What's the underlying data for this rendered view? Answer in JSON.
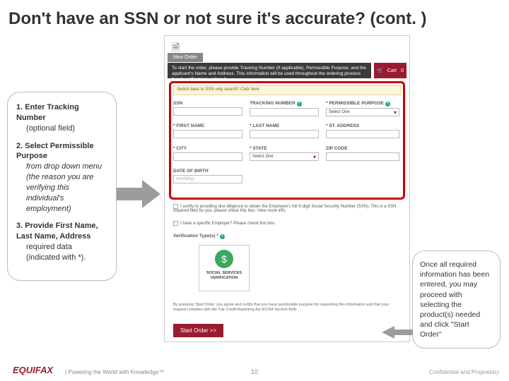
{
  "title": "Don't have an SSN or not sure it's accurate? (cont. )",
  "callout_left": {
    "item1_num": "1.",
    "item1_bold": "Enter Tracking Number",
    "item1_rest": " (optional field)",
    "item2_num": "2.",
    "item2_bold": "Select Permissible Purpose",
    "item2_rest": " from drop down menu (the reason you are verifying this individual's employment)",
    "item3_num": "3.",
    "item3_bold": "Provide First Name, Last Name, Address",
    "item3_rest": " required data (indicated with *)."
  },
  "callout_right": "Once all required information has been entered, you may proceed with selecting the product(s) needed and click \"Start Order\"",
  "shot": {
    "tab": "New Order",
    "intro": "To start the order, please provide Tracking Number (if applicable), Permissible Purpose, and the applicant's Name and Address. This information will be used throughout the ordering process for all verifications ordered.",
    "cart_label": "Cart",
    "cart_count": "0",
    "hint": "Switch back to SSN only search? Click here",
    "f_ssn": "SSN",
    "f_tracking": "TRACKING NUMBER",
    "f_purpose": "* PERMISSIBLE PURPOSE",
    "purpose_placeholder": "Select One",
    "f_first": "* FIRST NAME",
    "f_last": "* LAST NAME",
    "f_addr": "* ST. ADDRESS",
    "f_city": "* CITY",
    "f_state": "* STATE",
    "state_placeholder": "Select One",
    "f_zip": "ZIP CODE",
    "f_dob": "DATE OF BIRTH",
    "dob_placeholder": "mm/dd/yy",
    "chk1": "I certify to providing due diligence to obtain the Employee's full 9-digit Social Security Number (SSN). This is a SSN required field for you, please check this box. View more info.",
    "chk2": "I have a specific Employer? Please check this box.",
    "vtype": "Verification Type(s) *",
    "tile_label": "SOCIAL SERVICES VERIFICATION",
    "fine": "By pressing 'Start Order' you agree and certify that you have permissible purpose for requesting this information and that your request complies with the Fair Credit Reporting Act (FCRA Section 604).",
    "start": "Start Order >>"
  },
  "footer": {
    "logo": "EQUIFAX",
    "tagline": "|   Powering the World with Knowledge™",
    "page": "10",
    "conf": "Confidential and Proprietary"
  }
}
